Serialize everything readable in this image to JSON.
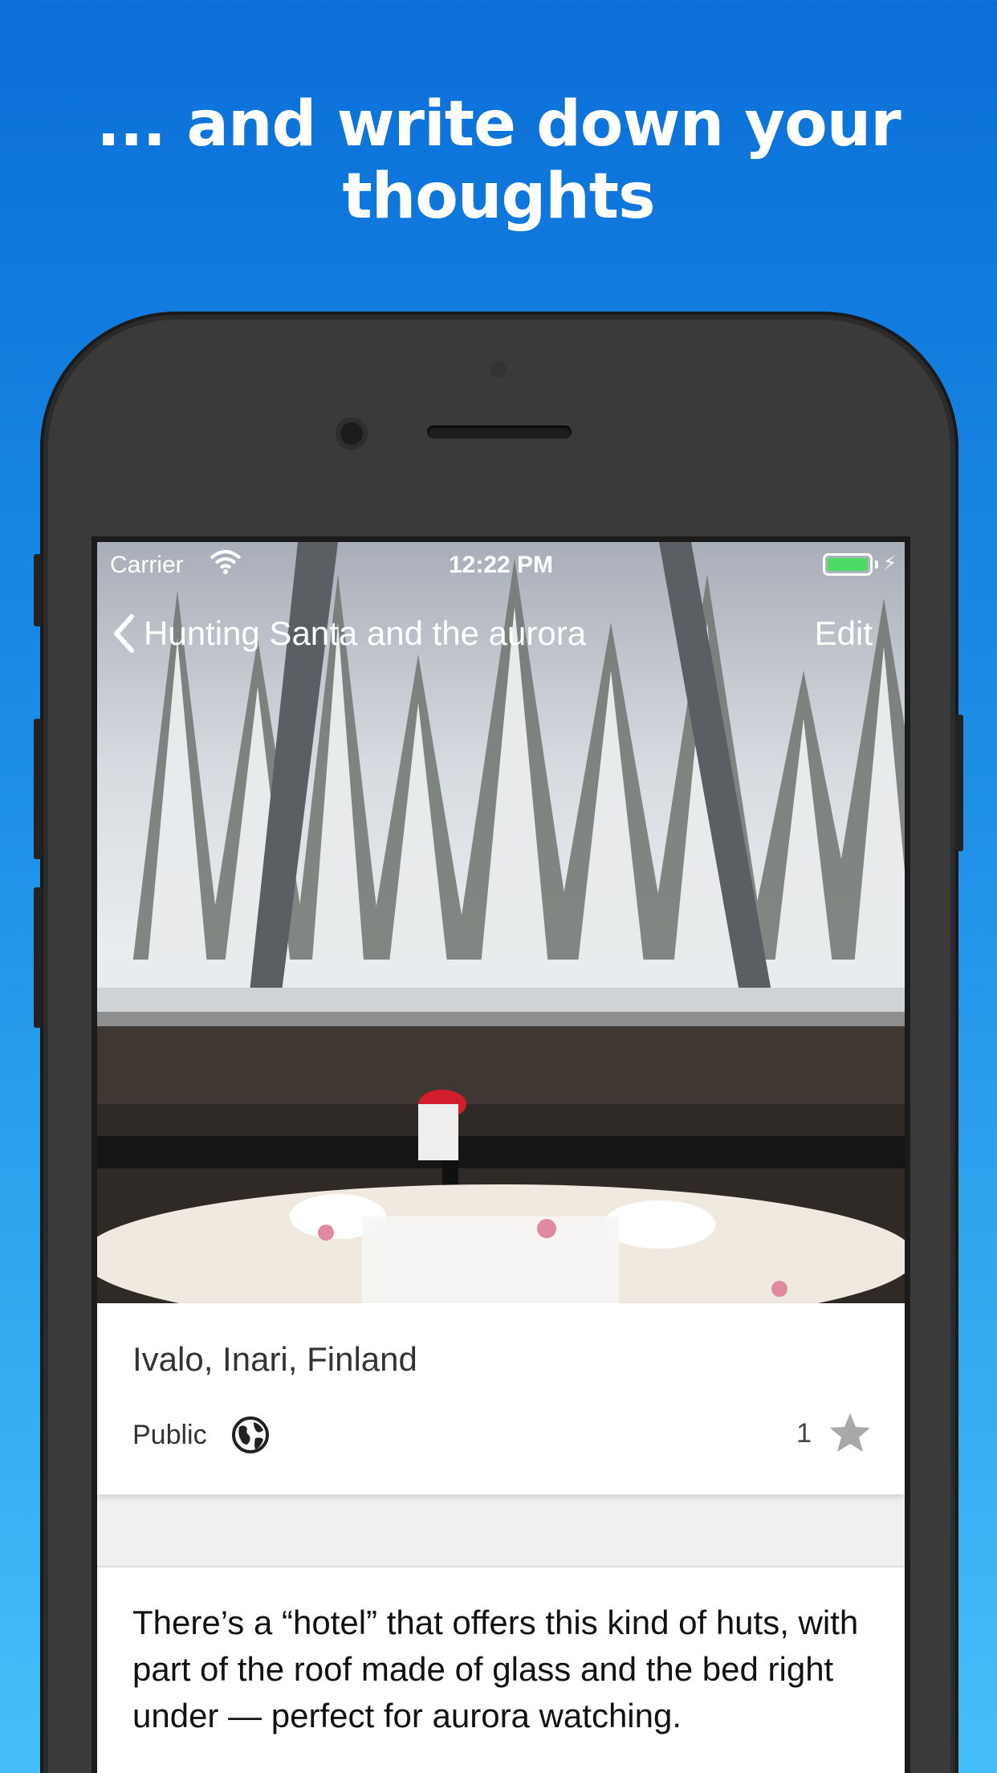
{
  "promo": {
    "headline_line1": "... and write down your",
    "headline_line2": "thoughts"
  },
  "status_bar": {
    "carrier": "Carrier",
    "time": "12:22 PM"
  },
  "nav": {
    "back_title": "Hunting Santa and the aurora",
    "edit_label": "Edit"
  },
  "entry": {
    "location": "Ivalo, Inari, Finland",
    "visibility": "Public",
    "likes": "1",
    "body": "There’s a “hotel” that offers this kind of huts, with part of the roof made of glass and the bed right under — perfect for aurora watching."
  },
  "colors": {
    "accent_gradient_top": "#0a6fd8",
    "accent_gradient_bottom": "#45bff8",
    "battery": "#4cd964",
    "star": "#a8a8a8"
  }
}
